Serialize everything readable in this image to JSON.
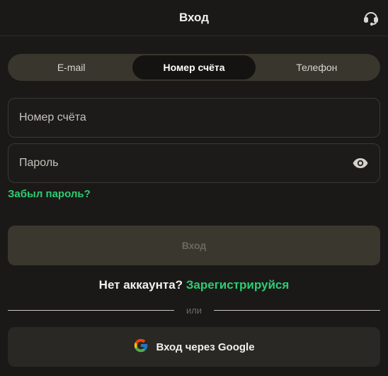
{
  "header": {
    "title": "Вход",
    "support_icon": "headset-icon"
  },
  "tabs": [
    {
      "label": "E-mail",
      "active": false
    },
    {
      "label": "Номер счёта",
      "active": true
    },
    {
      "label": "Телефон",
      "active": false
    }
  ],
  "form": {
    "account_placeholder": "Номер счёта",
    "account_value": "",
    "password_placeholder": "Пароль",
    "password_value": "",
    "password_toggle_icon": "eye-icon",
    "forgot_label": "Забыл пароль?",
    "submit_label": "Вход"
  },
  "register": {
    "prompt": "Нет аккаунта?",
    "link": "Зарегистрируйся"
  },
  "divider": {
    "label": "или"
  },
  "google": {
    "label": "Вход через Google",
    "icon": "google-icon"
  },
  "colors": {
    "accent": "#2ecc71",
    "background": "#1a1918",
    "tab_track": "#39362e",
    "tab_active": "#141312",
    "button_disabled": "#3a372f"
  }
}
